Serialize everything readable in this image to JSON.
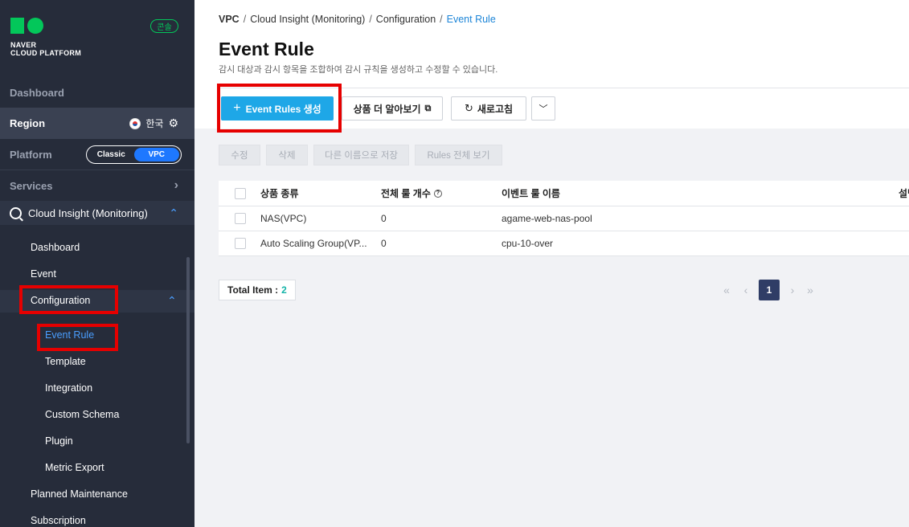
{
  "sidebar": {
    "logo_line1": "NAVER",
    "logo_line2": "CLOUD PLATFORM",
    "console_badge": "콘솔",
    "dashboard": "Dashboard",
    "region_label": "Region",
    "region_value": "한국",
    "platform_label": "Platform",
    "platform_options": [
      "Classic",
      "VPC"
    ],
    "platform_selected": "VPC",
    "services": "Services",
    "service_name": "Cloud Insight (Monitoring)",
    "menu": {
      "dashboard": "Dashboard",
      "event": "Event",
      "configuration": "Configuration",
      "config_items": [
        "Event Rule",
        "Template",
        "Integration",
        "Custom Schema",
        "Plugin",
        "Metric Export"
      ],
      "planned_maintenance": "Planned Maintenance",
      "subscription": "Subscription"
    }
  },
  "breadcrumb": [
    "VPC",
    "Cloud Insight (Monitoring)",
    "Configuration",
    "Event Rule"
  ],
  "page": {
    "title": "Event Rule",
    "description": "감시 대상과 감시 항목을 조합하여 감시 규칙을 생성하고 수정할 수 있습니다."
  },
  "toolbar": {
    "create_label": "Event Rules 생성",
    "learn_label": "상품 더 알아보기",
    "refresh_label": "새로고침"
  },
  "actions": [
    "수정",
    "삭제",
    "다른 이름으로 저장",
    "Rules 전체 보기"
  ],
  "table": {
    "columns": [
      "상품 종류",
      "전체 룰 개수",
      "이벤트 룰 이름",
      "설명"
    ],
    "rows": [
      {
        "product": "NAS(VPC)",
        "count": "0",
        "name": "agame-web-nas-pool"
      },
      {
        "product": "Auto Scaling Group(VP...",
        "count": "0",
        "name": "cpu-10-over"
      }
    ]
  },
  "footer": {
    "total_label": "Total Item :",
    "total_count": "2",
    "current_page": "1"
  },
  "colors": {
    "sidebar_bg": "#262c3a",
    "accent_green": "#03c75a",
    "primary_button": "#1ea7e7",
    "highlight_red": "#e60000",
    "active_link": "#4a9eff"
  }
}
